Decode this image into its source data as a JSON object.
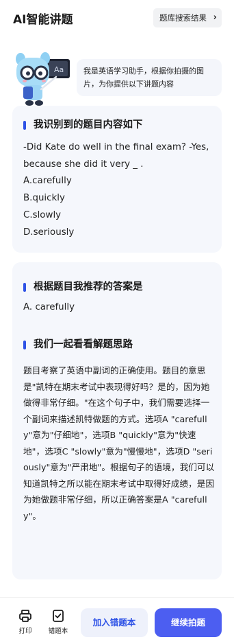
{
  "header": {
    "title": "AI智能讲题",
    "bank_button": "题库搜索结果"
  },
  "intro": "我是英语学习助手，根据你拍摄的图片，为你提供以下讲题内容",
  "recognition": {
    "title": "我识别到的题目内容如下",
    "question": "-Did Kate do well in the final exam? -Yes, because she did it very _ .",
    "options": [
      "A.carefully",
      "B.quickly",
      "C.slowly",
      "D.seriously"
    ]
  },
  "recommend": {
    "title": "根据题目我推荐的答案是",
    "answer": "A. carefully"
  },
  "explanation": {
    "title": "我们一起看看解题思路",
    "text": "题目考察了英语中副词的正确使用。题目的意思是\"凯特在期末考试中表现得好吗？是的，因为她做得非常仔细。\"在这个句子中，我们需要选择一个副词来描述凯特做题的方式。选项A \"carefully\"意为\"仔细地\"，选项B \"quickly\"意为\"快速地\"，选项C \"slowly\"意为\"慢慢地\"，选项D \"seriously\"意为\"严肃地\"。根据句子的语境，我们可以知道凯特之所以能在期末考试中取得好成绩，是因为她做题非常仔细，所以正确答案是A \"carefully\"。"
  },
  "bottom": {
    "print_label": "打印",
    "wrongbook_label": "错题本",
    "add_button": "加入错题本",
    "continue_button": "继续拍题"
  },
  "colors": {
    "accent": "#4c5ef1",
    "title_bar": "#2e52e6",
    "card_bg": "#f5f7fc"
  },
  "icons": {
    "mascot": "robot-mascot-illustration",
    "print": "printer-icon",
    "wrongbook": "wrongbook-icon",
    "chevron": "chevron-right-icon"
  }
}
